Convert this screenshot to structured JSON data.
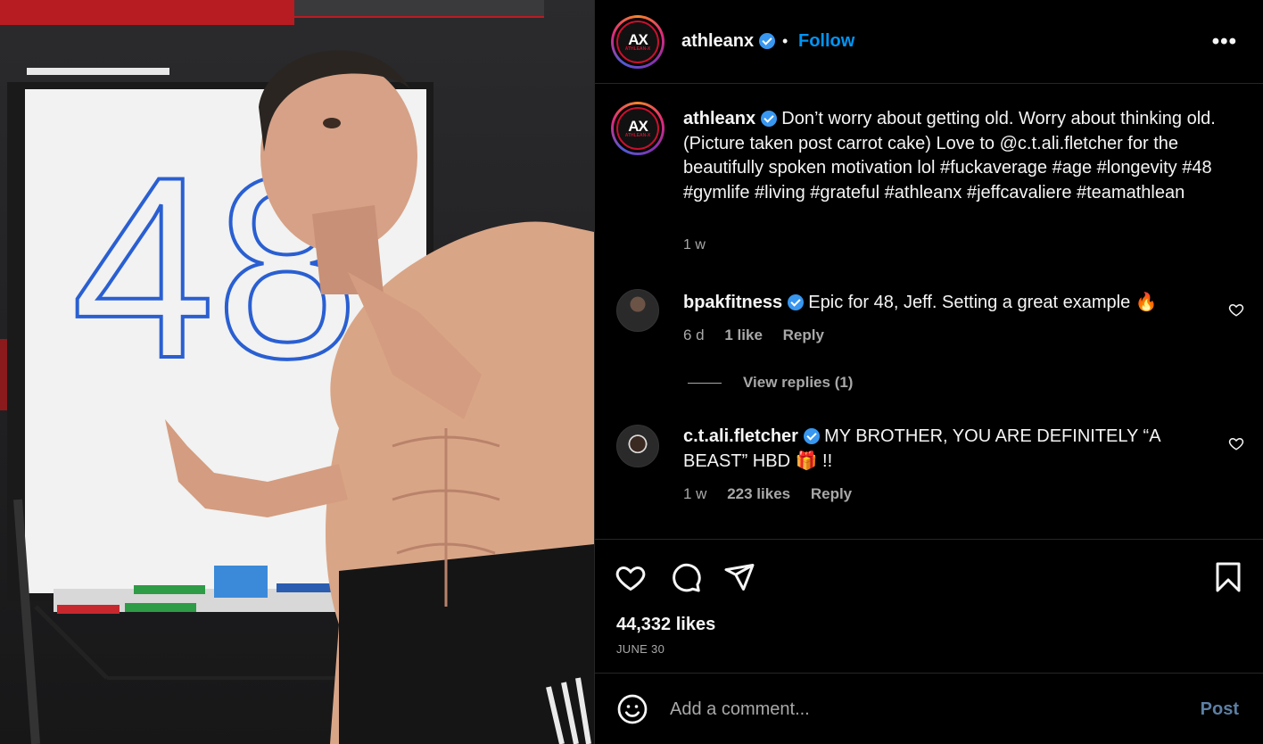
{
  "post": {
    "author": "athleanx",
    "follow_label": "Follow",
    "dot": "•",
    "more": "•••",
    "avatar_logo": "AX",
    "avatar_logo_sub": "ATHLEAN-X",
    "whiteboard_number": "48",
    "caption_text": "Don’t worry about getting old. Worry about thinking old. (Picture taken post carrot cake) Love to @c.t.ali.fletcher for the beautifully spoken motivation lol #fuckaverage #age #longevity #48 #gymlife #living #grateful #athleanx #jeffcavaliere #teamathlean",
    "caption_time": "1 w",
    "likes": "44,332 likes",
    "date": "JUNE 30"
  },
  "comments": [
    {
      "username": "bpakfitness",
      "text": "Epic for 48, Jeff. Setting a great example 🔥",
      "time": "6 d",
      "likes": "1 like",
      "reply": "Reply",
      "view_replies": "View replies (1)"
    },
    {
      "username": "c.t.ali.fletcher",
      "text": "MY BROTHER, YOU ARE DEFINITELY “A BEAST” HBD 🎁 !!",
      "time": "1 w",
      "likes": "223 likes",
      "reply": "Reply"
    }
  ],
  "comment_box": {
    "placeholder": "Add a comment...",
    "post_label": "Post"
  },
  "colors": {
    "accent": "#0095f6",
    "verified": "#3897f0",
    "secondary_text": "#a8a8a8",
    "post_disabled": "#5c7fa3"
  },
  "icons": [
    "heart-icon",
    "comment-icon",
    "share-icon",
    "bookmark-icon",
    "emoji-icon",
    "verified-icon",
    "more-icon"
  ]
}
